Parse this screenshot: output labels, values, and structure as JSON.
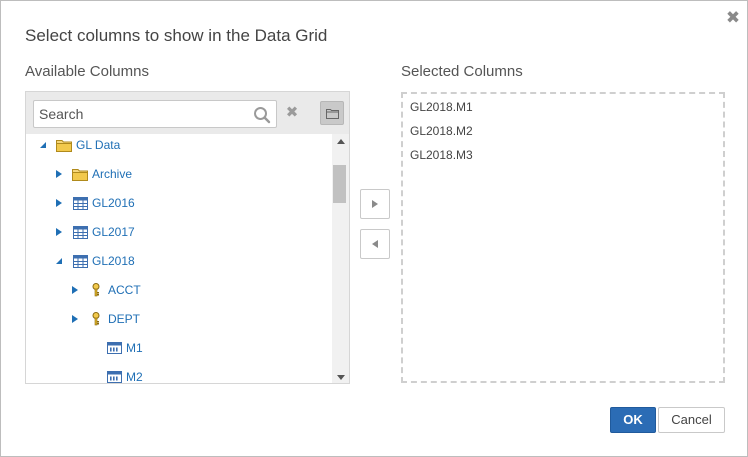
{
  "dialog": {
    "title": "Select columns to show in the Data Grid",
    "close_icon": "close-icon"
  },
  "available": {
    "label": "Available Columns",
    "search": {
      "placeholder": "Search",
      "value": ""
    },
    "tree": [
      {
        "label": "GL Data",
        "icon": "folder-icon",
        "expanded": true
      },
      {
        "label": "Archive",
        "icon": "folder-icon",
        "expanded": false
      },
      {
        "label": "GL2016",
        "icon": "table-icon",
        "expanded": false
      },
      {
        "label": "GL2017",
        "icon": "table-icon",
        "expanded": false
      },
      {
        "label": "GL2018",
        "icon": "table-icon",
        "expanded": true
      },
      {
        "label": "ACCT",
        "icon": "key-icon",
        "expanded": false
      },
      {
        "label": "DEPT",
        "icon": "key-icon",
        "expanded": false
      },
      {
        "label": "M1",
        "icon": "column-icon"
      },
      {
        "label": "M2",
        "icon": "column-icon"
      }
    ]
  },
  "selected": {
    "label": "Selected Columns",
    "items": [
      "GL2018.M1",
      "GL2018.M2",
      "GL2018.M3"
    ]
  },
  "footer": {
    "ok_label": "OK",
    "cancel_label": "Cancel"
  },
  "colors": {
    "accent": "#2b6cb5",
    "tree_text": "#1f6fb5",
    "folder": "#f2c94c",
    "key": "#e0b52a"
  }
}
